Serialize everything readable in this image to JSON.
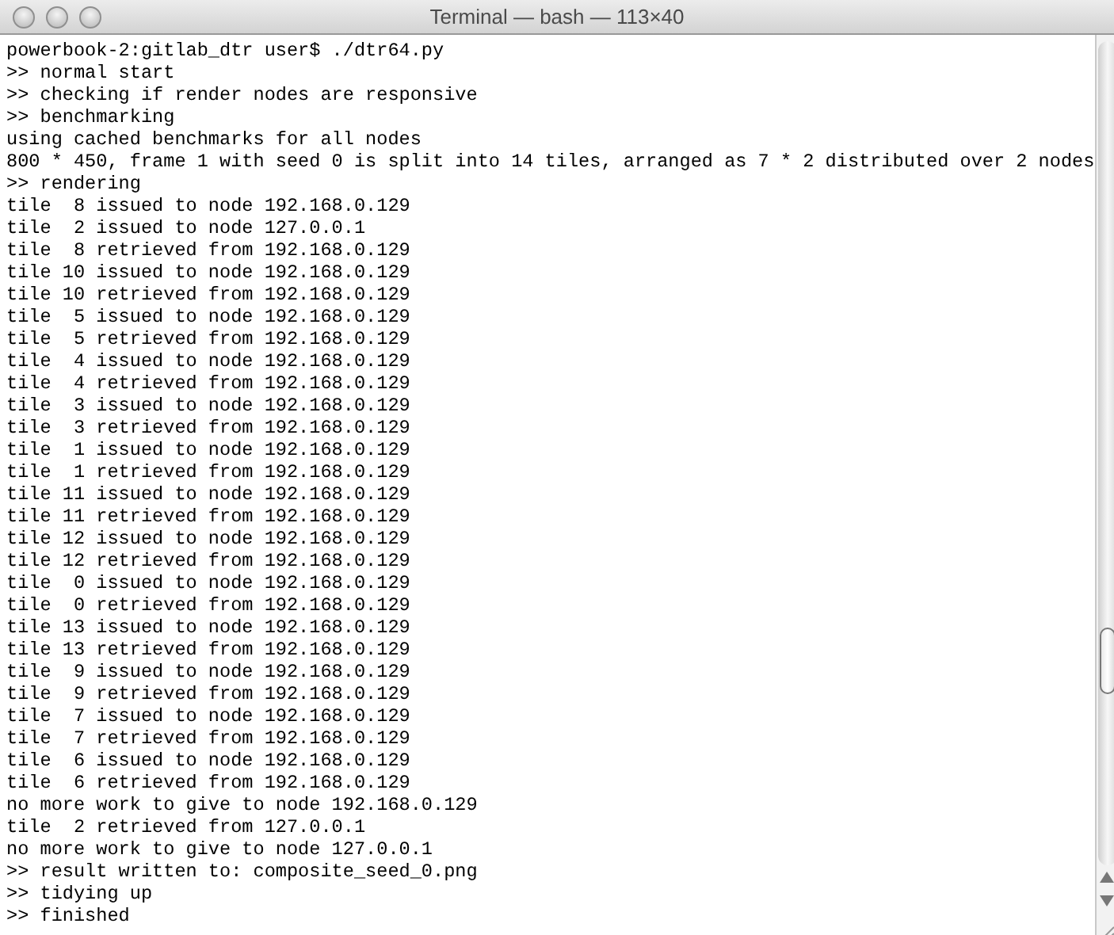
{
  "window": {
    "title": "Terminal — bash — 113×40"
  },
  "terminal": {
    "lines": [
      "powerbook-2:gitlab_dtr user$ ./dtr64.py",
      ">> normal start",
      ">> checking if render nodes are responsive",
      ">> benchmarking",
      "using cached benchmarks for all nodes",
      "800 * 450, frame 1 with seed 0 is split into 14 tiles, arranged as 7 * 2 distributed over 2 nodes",
      ">> rendering",
      "tile  8 issued to node 192.168.0.129",
      "tile  2 issued to node 127.0.0.1",
      "tile  8 retrieved from 192.168.0.129",
      "tile 10 issued to node 192.168.0.129",
      "tile 10 retrieved from 192.168.0.129",
      "tile  5 issued to node 192.168.0.129",
      "tile  5 retrieved from 192.168.0.129",
      "tile  4 issued to node 192.168.0.129",
      "tile  4 retrieved from 192.168.0.129",
      "tile  3 issued to node 192.168.0.129",
      "tile  3 retrieved from 192.168.0.129",
      "tile  1 issued to node 192.168.0.129",
      "tile  1 retrieved from 192.168.0.129",
      "tile 11 issued to node 192.168.0.129",
      "tile 11 retrieved from 192.168.0.129",
      "tile 12 issued to node 192.168.0.129",
      "tile 12 retrieved from 192.168.0.129",
      "tile  0 issued to node 192.168.0.129",
      "tile  0 retrieved from 192.168.0.129",
      "tile 13 issued to node 192.168.0.129",
      "tile 13 retrieved from 192.168.0.129",
      "tile  9 issued to node 192.168.0.129",
      "tile  9 retrieved from 192.168.0.129",
      "tile  7 issued to node 192.168.0.129",
      "tile  7 retrieved from 192.168.0.129",
      "tile  6 issued to node 192.168.0.129",
      "tile  6 retrieved from 192.168.0.129",
      "no more work to give to node 192.168.0.129",
      "tile  2 retrieved from 127.0.0.1",
      "no more work to give to node 127.0.0.1",
      ">> result written to: composite_seed_0.png",
      ">> tidying up",
      ">> finished"
    ]
  }
}
